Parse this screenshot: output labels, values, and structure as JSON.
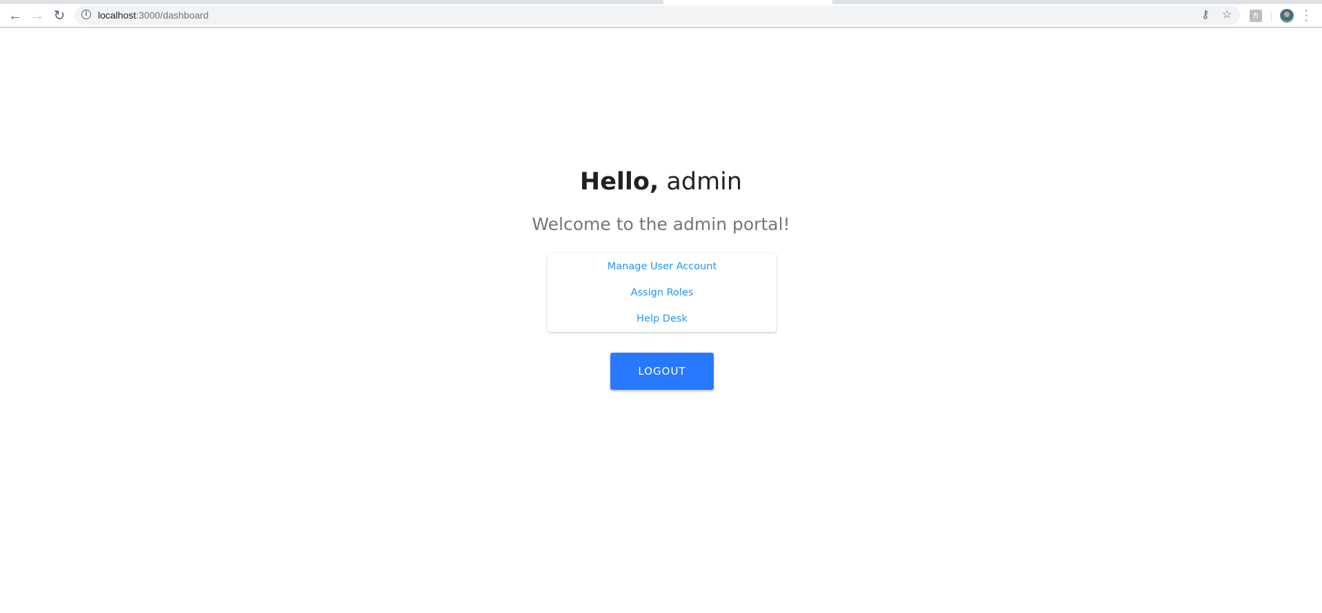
{
  "browser": {
    "url_host": "localhost",
    "url_rest": ":3000/dashboard",
    "extension_label": "ℏ"
  },
  "page": {
    "greeting_bold": "Hello,",
    "greeting_name": " admin",
    "welcome": "Welcome to the admin portal!",
    "links": [
      "Manage User Account",
      "Assign Roles",
      "Help Desk"
    ],
    "logout_label": "LOGOUT"
  },
  "colors": {
    "link": "#2196f3",
    "button": "#2979ff"
  }
}
